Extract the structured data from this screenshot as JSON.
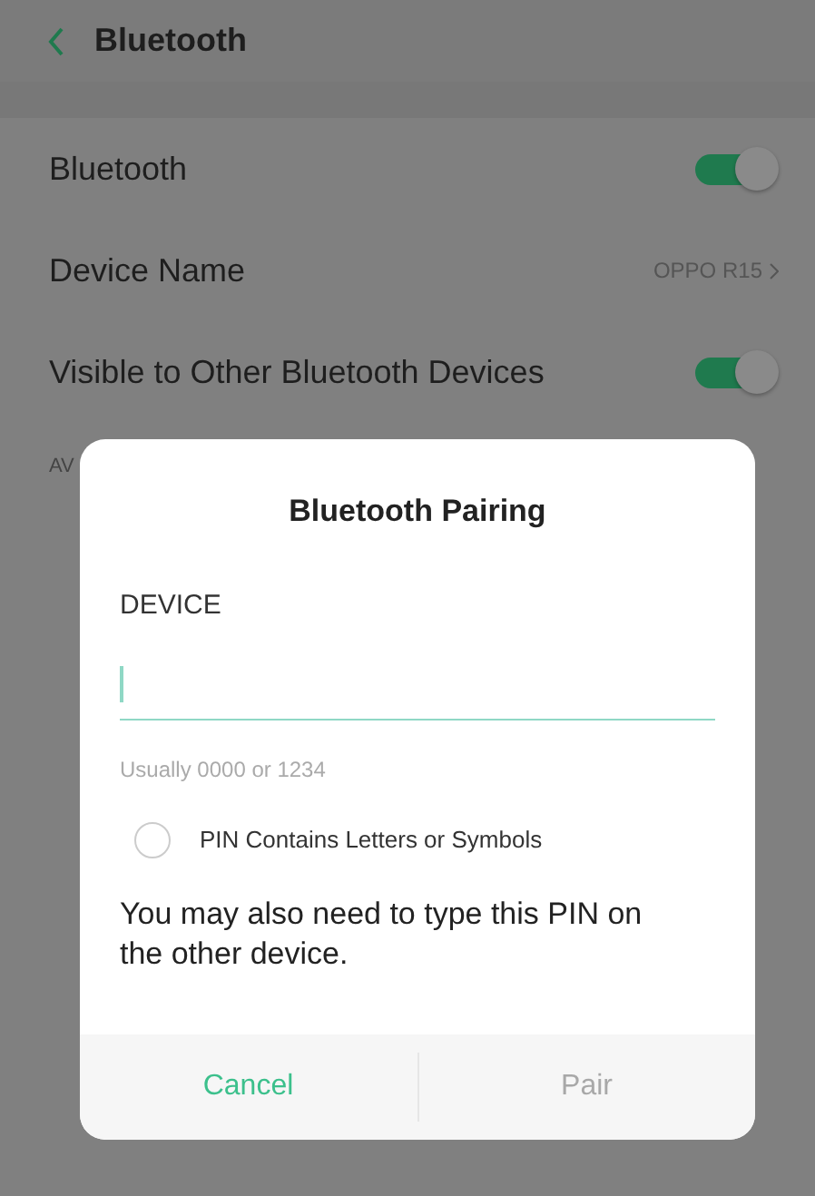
{
  "header": {
    "title": "Bluetooth"
  },
  "settings": [
    {
      "kind": "toggle",
      "label": "Bluetooth",
      "on": true
    },
    {
      "kind": "value",
      "label": "Device Name",
      "value": "OPPO R15"
    },
    {
      "kind": "toggle",
      "label": "Visible to Other Bluetooth Devices",
      "on": true
    }
  ],
  "section_header": "AV",
  "dialog": {
    "title": "Bluetooth Pairing",
    "field_label": "DEVICE",
    "pin_field": {
      "focused": true
    },
    "helper": "Usually 0000 or 1234",
    "option": {
      "label": "PIN Contains Letters or Symbols",
      "checked": false
    },
    "message": "You may also need to type this PIN on the other device.",
    "buttons": [
      {
        "label": "Cancel",
        "disabled": false
      },
      {
        "label": "Pair",
        "disabled": true
      }
    ]
  }
}
